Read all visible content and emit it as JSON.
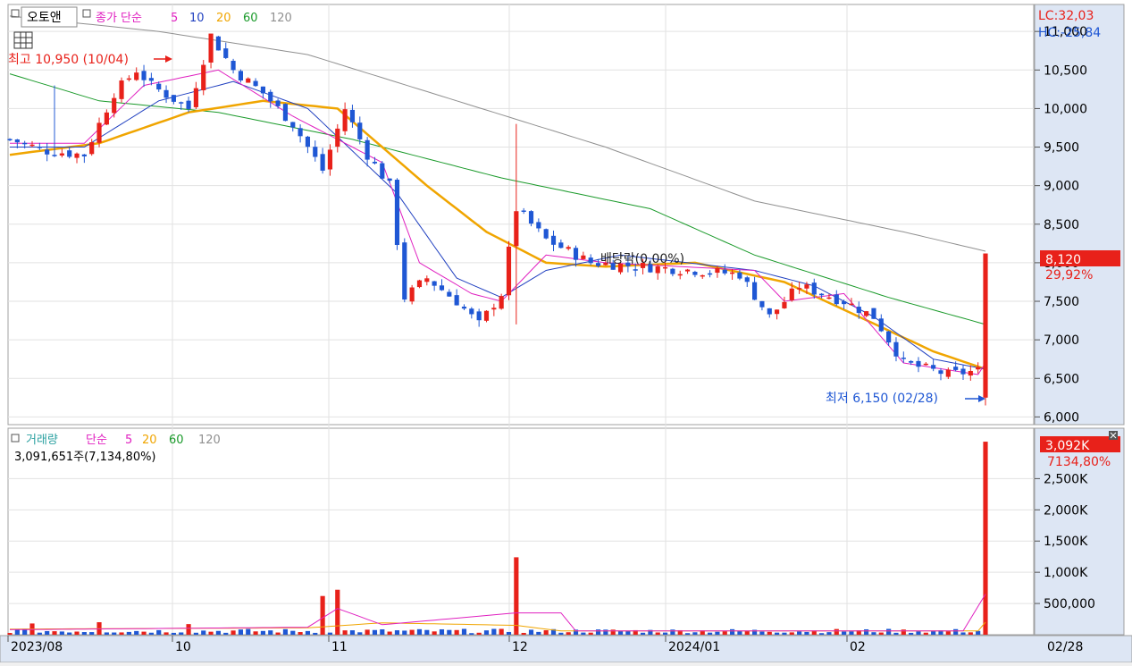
{
  "price_panel": {
    "ticker": "오토앤",
    "ma_header": {
      "kind": "종가 단순",
      "p5": "5",
      "p10": "10",
      "p20": "20",
      "p60": "60",
      "p120": "120"
    },
    "lc": "LC:32,03",
    "hc": "HC:-25,84",
    "current_price": "8,120",
    "current_change": "29,92%",
    "high_note": "최고 10,950 (10/04)",
    "low_note": "최저 6,150 (02/28)",
    "dividend_note": "배당락(0,00%)",
    "y_ticks": [
      "11,000",
      "10,500",
      "10,000",
      "9,500",
      "9,000",
      "8,500",
      "8,000",
      "7,500",
      "7,000",
      "6,500",
      "6,000"
    ]
  },
  "volume_panel": {
    "title": "거래량",
    "ma_header": {
      "kind": "단순",
      "p5": "5",
      "p20": "20",
      "p60": "60",
      "p120": "120"
    },
    "volume_readout": "3,091,651주(7,134,80%)",
    "current_volume": "3,092K",
    "current_volume_pct": "7134,80%",
    "y_ticks": [
      "2,500K",
      "2,000K",
      "1,500K",
      "1,000K",
      "500,000"
    ]
  },
  "x_axis": {
    "labels": [
      "2023/08",
      "10",
      "11",
      "12",
      "2024/01",
      "02"
    ],
    "cursor_date": "02/28"
  },
  "colors": {
    "up": "#e8211a",
    "down": "#1f57d4",
    "ma5": "#e020c0",
    "ma10": "#2040c0",
    "ma20": "#f0a500",
    "ma60": "#1a9a2a",
    "ma120": "#909090",
    "axis_bg": "#dde6f4"
  },
  "chart_data": {
    "type": "candlestick",
    "price_range": [
      5900,
      11350
    ],
    "volume_range": [
      0,
      3150000
    ],
    "n_bars": 132,
    "ohlc_keyframes": [
      {
        "i": 0,
        "c": 9600
      },
      {
        "i": 5,
        "c": 9450
      },
      {
        "i": 10,
        "c": 9400
      },
      {
        "i": 14,
        "c": 10200
      },
      {
        "i": 17,
        "c": 10500
      },
      {
        "i": 19,
        "c": 10300
      },
      {
        "i": 24,
        "c": 10000
      },
      {
        "i": 27,
        "c": 10950
      },
      {
        "i": 30,
        "c": 10500
      },
      {
        "i": 34,
        "c": 10200
      },
      {
        "i": 38,
        "c": 9800
      },
      {
        "i": 42,
        "c": 9200
      },
      {
        "i": 45,
        "c": 10000
      },
      {
        "i": 48,
        "c": 9400
      },
      {
        "i": 51,
        "c": 9000
      },
      {
        "i": 53,
        "c": 7550
      },
      {
        "i": 56,
        "c": 7800
      },
      {
        "i": 60,
        "c": 7500
      },
      {
        "i": 63,
        "c": 7200
      },
      {
        "i": 66,
        "c": 7600
      },
      {
        "i": 68,
        "c": 8700
      },
      {
        "i": 72,
        "c": 8300
      },
      {
        "i": 78,
        "c": 8000
      },
      {
        "i": 85,
        "c": 7950
      },
      {
        "i": 92,
        "c": 7900
      },
      {
        "i": 98,
        "c": 7850
      },
      {
        "i": 102,
        "c": 7300
      },
      {
        "i": 106,
        "c": 7700
      },
      {
        "i": 112,
        "c": 7500
      },
      {
        "i": 116,
        "c": 7300
      },
      {
        "i": 120,
        "c": 6700
      },
      {
        "i": 126,
        "c": 6550
      },
      {
        "i": 130,
        "c": 6600
      },
      {
        "i": 131,
        "c": 6600
      }
    ],
    "last_bar": {
      "open": 6250,
      "high": 8120,
      "low": 6150,
      "close": 8120,
      "volume": 3091651
    },
    "high_marker": {
      "price": 10950,
      "date": "10/04"
    },
    "low_marker": {
      "price": 6150,
      "date": "02/28"
    },
    "ma5": [
      [
        0,
        9550
      ],
      [
        10,
        9550
      ],
      [
        18,
        10300
      ],
      [
        28,
        10500
      ],
      [
        38,
        9900
      ],
      [
        50,
        9300
      ],
      [
        55,
        8000
      ],
      [
        62,
        7600
      ],
      [
        66,
        7500
      ],
      [
        72,
        8100
      ],
      [
        80,
        8000
      ],
      [
        100,
        7900
      ],
      [
        104,
        7500
      ],
      [
        112,
        7600
      ],
      [
        120,
        6700
      ],
      [
        130,
        6550
      ],
      [
        131,
        6700
      ]
    ],
    "ma10": [
      [
        0,
        9500
      ],
      [
        10,
        9500
      ],
      [
        20,
        10100
      ],
      [
        30,
        10350
      ],
      [
        40,
        10000
      ],
      [
        52,
        8900
      ],
      [
        60,
        7800
      ],
      [
        66,
        7550
      ],
      [
        72,
        7900
      ],
      [
        82,
        8100
      ],
      [
        100,
        7900
      ],
      [
        108,
        7700
      ],
      [
        116,
        7300
      ],
      [
        124,
        6750
      ],
      [
        131,
        6620
      ]
    ],
    "ma20": [
      [
        0,
        9400
      ],
      [
        12,
        9550
      ],
      [
        24,
        9950
      ],
      [
        34,
        10100
      ],
      [
        44,
        10000
      ],
      [
        56,
        9000
      ],
      [
        64,
        8400
      ],
      [
        72,
        8000
      ],
      [
        80,
        7950
      ],
      [
        92,
        8000
      ],
      [
        104,
        7750
      ],
      [
        114,
        7300
      ],
      [
        124,
        6850
      ],
      [
        131,
        6620
      ]
    ],
    "ma60": [
      [
        0,
        10450
      ],
      [
        12,
        10100
      ],
      [
        28,
        9950
      ],
      [
        46,
        9600
      ],
      [
        66,
        9100
      ],
      [
        86,
        8700
      ],
      [
        100,
        8100
      ],
      [
        118,
        7550
      ],
      [
        131,
        7200
      ]
    ],
    "ma120": [
      [
        0,
        11200
      ],
      [
        20,
        11000
      ],
      [
        40,
        10700
      ],
      [
        60,
        10100
      ],
      [
        80,
        9500
      ],
      [
        100,
        8800
      ],
      [
        120,
        8400
      ],
      [
        131,
        8150
      ]
    ],
    "volume_spikes": [
      {
        "i": 3,
        "v": 180000
      },
      {
        "i": 12,
        "v": 200000
      },
      {
        "i": 24,
        "v": 170000
      },
      {
        "i": 42,
        "v": 620000
      },
      {
        "i": 44,
        "v": 720000
      },
      {
        "i": 68,
        "v": 1240000
      },
      {
        "i": 131,
        "v": 3091651
      }
    ],
    "vol_ma5": [
      [
        0,
        80000
      ],
      [
        40,
        120000
      ],
      [
        44,
        420000
      ],
      [
        50,
        160000
      ],
      [
        68,
        350000
      ],
      [
        74,
        350000
      ],
      [
        76,
        60000
      ],
      [
        128,
        60000
      ],
      [
        131,
        650000
      ]
    ],
    "vol_ma20": [
      [
        0,
        90000
      ],
      [
        40,
        110000
      ],
      [
        50,
        190000
      ],
      [
        68,
        150000
      ],
      [
        74,
        60000
      ],
      [
        130,
        60000
      ],
      [
        131,
        200000
      ]
    ]
  }
}
